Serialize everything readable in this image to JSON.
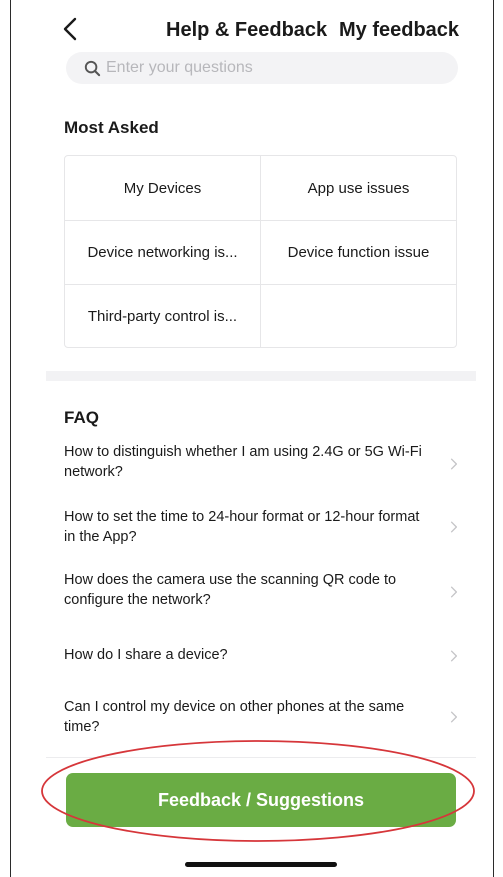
{
  "header": {
    "title": "Help & Feedback",
    "right_action": "My feedback",
    "back_icon": "chevron-left-icon"
  },
  "search": {
    "placeholder": "Enter your questions",
    "icon": "search-icon"
  },
  "most_asked": {
    "title": "Most Asked",
    "items": [
      "My Devices",
      "App use issues",
      "Device networking is...",
      "Device function issue",
      "Third-party control is..."
    ]
  },
  "faq": {
    "title": "FAQ",
    "chevron_icon": "chevron-right-icon",
    "items": [
      "How to distinguish whether I am using 2.4G or 5G Wi-Fi network?",
      "How to set the time to 24-hour format or 12-hour format in the App?",
      "How does the camera use the scanning QR code to configure the network?",
      "How do I share a device?",
      "Can I control my device on other phones at the same time?"
    ]
  },
  "footer": {
    "button_label": "Feedback / Suggestions"
  },
  "colors": {
    "accent_green": "#6aac44",
    "annotation_red": "#d6363a",
    "text": "#1a1a1a",
    "placeholder": "#b7b7bb"
  }
}
